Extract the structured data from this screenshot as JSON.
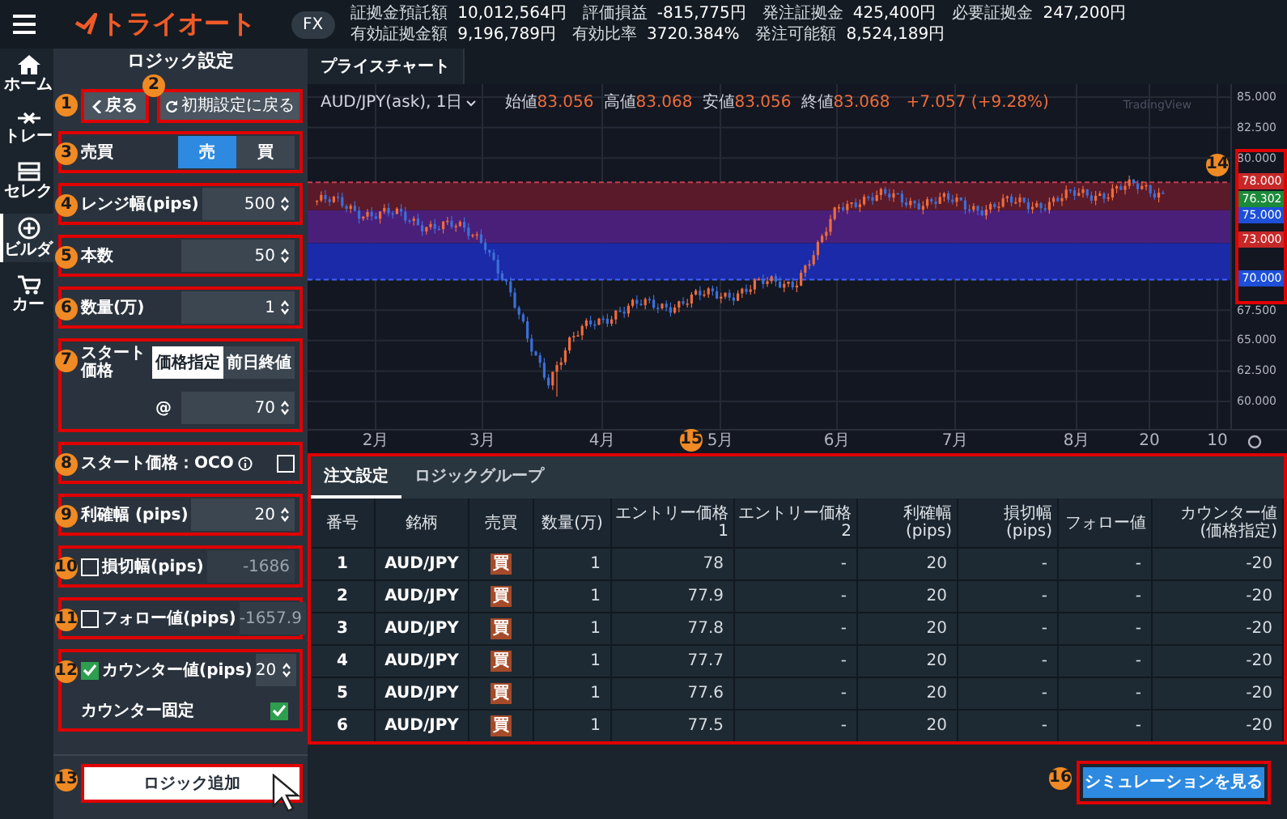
{
  "header": {
    "logo": "トライオート",
    "market": "FX",
    "stats": [
      [
        {
          "label": "証拠金預託額",
          "value": "10,012,564円"
        },
        {
          "label": "評価損益",
          "value": "-815,775円"
        },
        {
          "label": "発注証拠金",
          "value": "425,400円"
        },
        {
          "label": "必要証拠金",
          "value": "247,200円"
        }
      ],
      [
        {
          "label": "有効証拠金額",
          "value": "9,196,789円"
        },
        {
          "label": "有効比率",
          "value": "3720.384%"
        },
        {
          "label": "発注可能額",
          "value": "8,524,189円"
        }
      ]
    ]
  },
  "nav": [
    {
      "label": "ホーム",
      "selected": false
    },
    {
      "label": "トレー",
      "selected": false
    },
    {
      "label": "セレク",
      "selected": false
    },
    {
      "label": "ビルダ",
      "selected": true
    },
    {
      "label": "カー",
      "selected": false
    }
  ],
  "panel": {
    "title": "ロジック設定",
    "back": "戻る",
    "reset": "初期設定に戻る",
    "fields": [
      {
        "kind": "segment",
        "label": "売買",
        "options": [
          {
            "label": "売",
            "selected": true
          },
          {
            "label": "買",
            "selected": false
          }
        ]
      },
      {
        "kind": "number",
        "label": "レンジ幅(pips)",
        "value": "500"
      },
      {
        "kind": "number",
        "label": "本数",
        "value": "50"
      },
      {
        "kind": "number",
        "label": "数量(万)",
        "value": "1"
      },
      {
        "kind": "start",
        "label": "スタート価格",
        "options": [
          {
            "label": "価格指定",
            "selected": true
          },
          {
            "label": "前日終値",
            "selected": false
          }
        ],
        "at": "@",
        "value": "70"
      },
      {
        "kind": "check_right",
        "label": "スタート価格：OCO",
        "checked": false
      },
      {
        "kind": "number",
        "label": "利確幅 (pips)",
        "value": "20"
      },
      {
        "kind": "check_number",
        "label": "損切幅(pips)",
        "checked": false,
        "value": "-1686"
      },
      {
        "kind": "check_number",
        "label": "フォロー値(pips)",
        "checked": false,
        "value": "-1657.9"
      },
      {
        "kind": "counter",
        "label": "カウンター値(pips)",
        "checked": true,
        "value": "20",
        "sub_label": "カウンター固定",
        "sub_checked": true
      }
    ],
    "add_button": "ロジック追加"
  },
  "chart": {
    "tab": "プライスチャート",
    "symbol": "AUD/JPY(ask), 1日",
    "ohlc": [
      {
        "label": "始値",
        "value": "83.056"
      },
      {
        "label": "高値",
        "value": "83.068"
      },
      {
        "label": "安値",
        "value": "83.056"
      },
      {
        "label": "終値",
        "value": "83.068"
      }
    ],
    "change": "+7.057 (+9.28%)",
    "watermark": "TradingView",
    "y_ticks": [
      "85.000",
      "82.500",
      "80.000",
      "67.500",
      "65.000",
      "62.500",
      "60.000"
    ],
    "price_tags": [
      {
        "value": "78.000",
        "color": "#c62828"
      },
      {
        "value": "76.302",
        "color": "#1b8a3a"
      },
      {
        "value": "75.000",
        "color": "#1d4fd8"
      },
      {
        "value": "73.000",
        "color": "#c62828"
      },
      {
        "value": "70.000",
        "color": "#1d4fd8"
      }
    ],
    "x_ticks": [
      "2月",
      "3月",
      "4月",
      "5月",
      "6月",
      "7月",
      "8月",
      "20",
      "10"
    ]
  },
  "orders": {
    "tabs": [
      {
        "label": "注文設定",
        "selected": true
      },
      {
        "label": "ロジックグループ",
        "selected": false
      }
    ],
    "columns": [
      "番号",
      "銘柄",
      "売買",
      "数量(万)",
      "エントリー価格\n1",
      "エントリー価格\n2",
      "利確幅(pips)",
      "損切幅(pips)",
      "フォロー値",
      "カウンター値\n(価格指定)"
    ],
    "rows": [
      [
        "1",
        "AUD/JPY",
        "買",
        "1",
        "78",
        "-",
        "20",
        "-",
        "-",
        "-20"
      ],
      [
        "2",
        "AUD/JPY",
        "買",
        "1",
        "77.9",
        "-",
        "20",
        "-",
        "-",
        "-20"
      ],
      [
        "3",
        "AUD/JPY",
        "買",
        "1",
        "77.8",
        "-",
        "20",
        "-",
        "-",
        "-20"
      ],
      [
        "4",
        "AUD/JPY",
        "買",
        "1",
        "77.7",
        "-",
        "20",
        "-",
        "-",
        "-20"
      ],
      [
        "5",
        "AUD/JPY",
        "買",
        "1",
        "77.6",
        "-",
        "20",
        "-",
        "-",
        "-20"
      ],
      [
        "6",
        "AUD/JPY",
        "買",
        "1",
        "77.5",
        "-",
        "20",
        "-",
        "-",
        "-20"
      ]
    ]
  },
  "simulate_button": "シミュレーションを見る",
  "annotations": [
    "1",
    "2",
    "3",
    "4",
    "5",
    "6",
    "7",
    "8",
    "9",
    "10",
    "11",
    "12",
    "13",
    "14",
    "15",
    "16"
  ]
}
